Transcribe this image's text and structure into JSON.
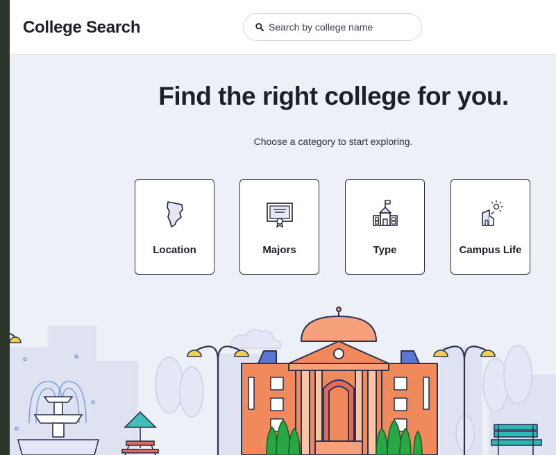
{
  "header": {
    "title": "College Search",
    "search_placeholder": "Search by college name",
    "search_icon": "search-icon"
  },
  "hero": {
    "title": "Find the right college for you.",
    "subtitle": "Choose a category to start exploring."
  },
  "categories": [
    {
      "label": "Location",
      "icon": "map-state-icon"
    },
    {
      "label": "Majors",
      "icon": "diploma-icon"
    },
    {
      "label": "Type",
      "icon": "school-building-icon"
    },
    {
      "label": "Campus Life",
      "icon": "campus-life-icon"
    }
  ],
  "colors": {
    "background": "#eef0f7",
    "building": "#f08a5d",
    "roof": "#5b77d4",
    "tree": "#27a844",
    "bench": "#2fb5b5"
  }
}
